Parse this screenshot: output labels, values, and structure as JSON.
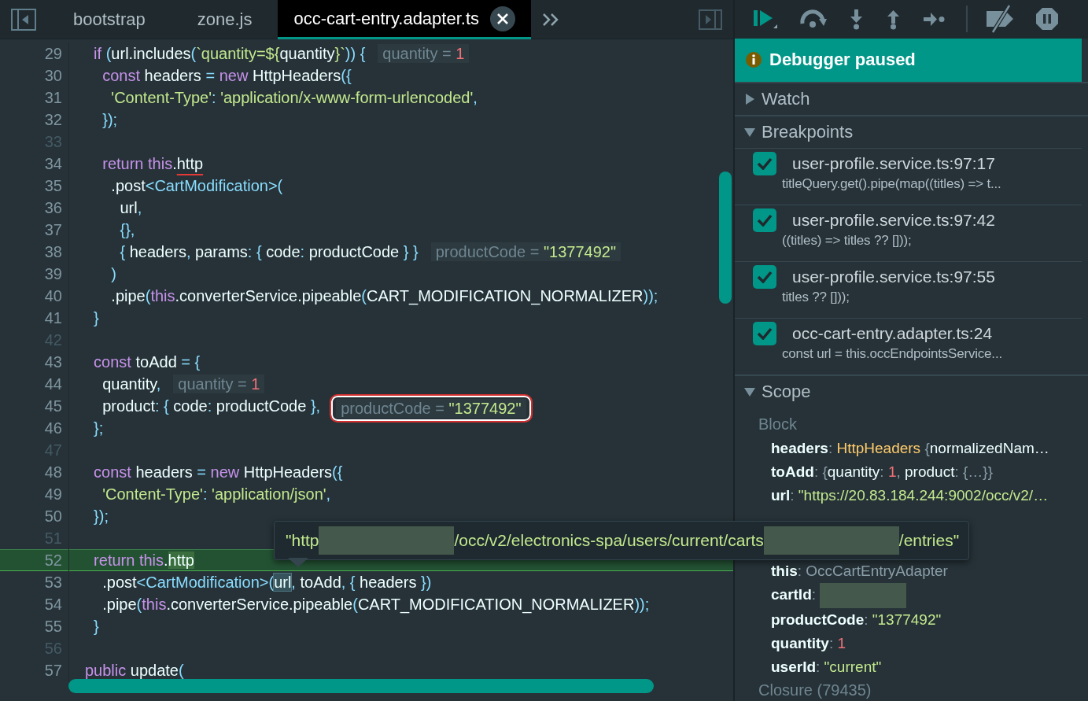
{
  "tabs": [
    {
      "label": "bootstrap",
      "selected": false
    },
    {
      "label": "zone.js",
      "selected": false
    },
    {
      "label": "occ-cart-entry.adapter.ts",
      "selected": true
    }
  ],
  "editor": {
    "lines": [
      {
        "number": "29",
        "paused": false,
        "tokens": [
          {
            "text": "  if ",
            "kind": "kw"
          },
          {
            "text": "(",
            "kind": "p"
          },
          {
            "text": "url.includes",
            "kind": "w"
          },
          {
            "text": "(",
            "kind": "p"
          },
          {
            "text": "`quantity=${",
            "kind": "s"
          },
          {
            "text": "quantity",
            "kind": "w"
          },
          {
            "text": "}`",
            "kind": "s"
          },
          {
            "text": ")) {",
            "kind": "p"
          }
        ],
        "hint": {
          "label": "quantity = ",
          "value": "1",
          "kind": "number",
          "highlighted": false
        }
      },
      {
        "number": "30",
        "paused": false,
        "tokens": [
          {
            "text": "    const ",
            "kind": "kw"
          },
          {
            "text": "headers ",
            "kind": "w"
          },
          {
            "text": "= ",
            "kind": "p"
          },
          {
            "text": "new ",
            "kind": "kw"
          },
          {
            "text": "HttpHeaders",
            "kind": "w"
          },
          {
            "text": "({",
            "kind": "p"
          }
        ]
      },
      {
        "number": "31",
        "paused": false,
        "tokens": [
          {
            "text": "      'Content-Type'",
            "kind": "s"
          },
          {
            "text": ": ",
            "kind": "p"
          },
          {
            "text": "'application/x-www-form-urlencoded'",
            "kind": "s"
          },
          {
            "text": ",",
            "kind": "p"
          }
        ]
      },
      {
        "number": "32",
        "paused": false,
        "tokens": [
          {
            "text": "    });",
            "kind": "p"
          }
        ]
      },
      {
        "number": "33",
        "paused": false
      },
      {
        "number": "34",
        "paused": false,
        "tokens": [
          {
            "text": "    return this",
            "kind": "kw"
          },
          {
            "text": ".",
            "kind": "w"
          },
          {
            "text": "http",
            "kind": "underlined"
          }
        ]
      },
      {
        "number": "35",
        "paused": false,
        "tokens": [
          {
            "text": "      .post",
            "kind": "w"
          },
          {
            "text": "<CartModification>(",
            "kind": "p"
          }
        ]
      },
      {
        "number": "36",
        "paused": false,
        "tokens": [
          {
            "text": "        url",
            "kind": "w"
          },
          {
            "text": ",",
            "kind": "p"
          }
        ]
      },
      {
        "number": "37",
        "paused": false,
        "tokens": [
          {
            "text": "        {},",
            "kind": "p"
          }
        ]
      },
      {
        "number": "38",
        "paused": false,
        "tokens": [
          {
            "text": "        { ",
            "kind": "p"
          },
          {
            "text": "headers",
            "kind": "w"
          },
          {
            "text": ", ",
            "kind": "p"
          },
          {
            "text": "params",
            "kind": "w"
          },
          {
            "text": ": { ",
            "kind": "p"
          },
          {
            "text": "code",
            "kind": "w"
          },
          {
            "text": ": ",
            "kind": "p"
          },
          {
            "text": "productCode",
            "kind": "w"
          },
          {
            "text": " } }",
            "kind": "p"
          }
        ],
        "hint": {
          "label": "productCode = ",
          "value": "\"1377492\"",
          "kind": "string",
          "highlighted": false
        }
      },
      {
        "number": "39",
        "paused": false,
        "tokens": [
          {
            "text": "      )",
            "kind": "p"
          }
        ]
      },
      {
        "number": "40",
        "paused": false,
        "tokens": [
          {
            "text": "      .pipe",
            "kind": "w"
          },
          {
            "text": "(",
            "kind": "p"
          },
          {
            "text": "this",
            "kind": "kw"
          },
          {
            "text": ".converterService.pipeable",
            "kind": "w"
          },
          {
            "text": "(",
            "kind": "p"
          },
          {
            "text": "CART_MODIFICATION_NORMALIZER",
            "kind": "w"
          },
          {
            "text": "));",
            "kind": "p"
          }
        ]
      },
      {
        "number": "41",
        "paused": false,
        "tokens": [
          {
            "text": "  }",
            "kind": "p"
          }
        ]
      },
      {
        "number": "42",
        "paused": false
      },
      {
        "number": "43",
        "paused": false,
        "tokens": [
          {
            "text": "  const ",
            "kind": "kw"
          },
          {
            "text": "toAdd ",
            "kind": "w"
          },
          {
            "text": "= {",
            "kind": "p"
          }
        ]
      },
      {
        "number": "44",
        "paused": false,
        "tokens": [
          {
            "text": "    quantity",
            "kind": "w"
          },
          {
            "text": ",",
            "kind": "p"
          }
        ],
        "hint": {
          "label": "quantity = ",
          "value": "1",
          "kind": "number",
          "highlighted": false
        }
      },
      {
        "number": "45",
        "paused": false,
        "tokens": [
          {
            "text": "    product",
            "kind": "w"
          },
          {
            "text": ": { ",
            "kind": "p"
          },
          {
            "text": "code",
            "kind": "w"
          },
          {
            "text": ": ",
            "kind": "p"
          },
          {
            "text": "productCode",
            "kind": "w"
          },
          {
            "text": " },",
            "kind": "p"
          }
        ],
        "hint": {
          "label": "productCode = ",
          "value": "\"1377492\"",
          "kind": "string",
          "highlighted": true
        }
      },
      {
        "number": "46",
        "paused": false,
        "tokens": [
          {
            "text": "  };",
            "kind": "p"
          }
        ]
      },
      {
        "number": "47",
        "paused": false
      },
      {
        "number": "48",
        "paused": false,
        "tokens": [
          {
            "text": "  const ",
            "kind": "kw"
          },
          {
            "text": "headers ",
            "kind": "w"
          },
          {
            "text": "= ",
            "kind": "p"
          },
          {
            "text": "new ",
            "kind": "kw"
          },
          {
            "text": "HttpHeaders",
            "kind": "w"
          },
          {
            "text": "({",
            "kind": "p"
          }
        ]
      },
      {
        "number": "49",
        "paused": false,
        "tokens": [
          {
            "text": "    'Content-Type'",
            "kind": "s"
          },
          {
            "text": ": ",
            "kind": "p"
          },
          {
            "text": "'application/json'",
            "kind": "s"
          },
          {
            "text": ",",
            "kind": "p"
          }
        ]
      },
      {
        "number": "50",
        "paused": false,
        "tokens": [
          {
            "text": "  });",
            "kind": "p"
          }
        ]
      },
      {
        "number": "51",
        "paused": false
      },
      {
        "number": "52",
        "paused": true,
        "tokens": [
          {
            "text": "  return this",
            "kind": "kw"
          },
          {
            "text": ".",
            "kind": "w"
          },
          {
            "text": "http",
            "kind": "current"
          }
        ]
      },
      {
        "number": "53",
        "paused": false,
        "tokens": [
          {
            "text": "    .post",
            "kind": "w"
          },
          {
            "text": "<CartModification>(",
            "kind": "p"
          },
          {
            "text": "url",
            "kind": "hovered"
          },
          {
            "text": ", ",
            "kind": "p"
          },
          {
            "text": "toAdd",
            "kind": "w"
          },
          {
            "text": ", { ",
            "kind": "p"
          },
          {
            "text": "headers",
            "kind": "w"
          },
          {
            "text": " })",
            "kind": "p"
          }
        ]
      },
      {
        "number": "54",
        "paused": false,
        "tokens": [
          {
            "text": "    .pipe",
            "kind": "w"
          },
          {
            "text": "(",
            "kind": "p"
          },
          {
            "text": "this",
            "kind": "kw"
          },
          {
            "text": ".converterService.pipeable",
            "kind": "w"
          },
          {
            "text": "(",
            "kind": "p"
          },
          {
            "text": "CART_MODIFICATION_NORMALIZER",
            "kind": "w"
          },
          {
            "text": "));",
            "kind": "p"
          }
        ]
      },
      {
        "number": "55",
        "paused": false,
        "tokens": [
          {
            "text": "  }",
            "kind": "p"
          }
        ]
      },
      {
        "number": "56",
        "paused": false
      },
      {
        "number": "57",
        "paused": false,
        "tokens": [
          {
            "text": "public ",
            "kind": "kw"
          },
          {
            "text": "update",
            "kind": "w"
          },
          {
            "text": "(",
            "kind": "p"
          }
        ]
      }
    ]
  },
  "tooltip": {
    "parts": [
      {
        "kind": "text",
        "text": "\"http"
      },
      {
        "kind": "redacted"
      },
      {
        "kind": "text",
        "text": "/occ/v2/electronics-spa/users/current/carts"
      },
      {
        "kind": "redacted"
      },
      {
        "kind": "text",
        "text": "/entries\""
      }
    ]
  },
  "debugger": {
    "status": "Debugger paused",
    "sections": [
      {
        "kind": "watch",
        "title": "Watch",
        "expanded": false
      },
      {
        "kind": "breakpoints",
        "title": "Breakpoints",
        "expanded": true,
        "items": [
          {
            "location": "user-profile.service.ts:97:17",
            "snippet": "titleQuery.get().pipe(map((titles) => t...",
            "checked": true
          },
          {
            "location": "user-profile.service.ts:97:42",
            "snippet": "((titles) => titles ?? []));",
            "checked": true
          },
          {
            "location": "user-profile.service.ts:97:55",
            "snippet": "titles ?? []));",
            "checked": true
          },
          {
            "location": "occ-cart-entry.adapter.ts:24",
            "snippet": "const url = this.occEndpointsService...",
            "checked": true
          }
        ]
      },
      {
        "kind": "scope",
        "title": "Scope",
        "expanded": true,
        "block": "Block",
        "closure": "Closure (79435)",
        "entries": [
          {
            "key": "headers",
            "value": [
              {
                "text": ": ",
                "kind": "dim"
              },
              {
                "text": "HttpHeaders ",
                "kind": "cls"
              },
              {
                "text": "{",
                "kind": "dim"
              },
              {
                "text": "normalizedNam…",
                "kind": "w"
              }
            ]
          },
          {
            "key": "toAdd",
            "value": [
              {
                "text": ": {",
                "kind": "dim"
              },
              {
                "text": "quantity",
                "kind": "w"
              },
              {
                "text": ": ",
                "kind": "dim"
              },
              {
                "text": "1",
                "kind": "num"
              },
              {
                "text": ", ",
                "kind": "dim"
              },
              {
                "text": "product",
                "kind": "w"
              },
              {
                "text": ": {…}}",
                "kind": "dim"
              }
            ]
          },
          {
            "key": "url",
            "value": [
              {
                "text": ": ",
                "kind": "dim"
              },
              {
                "text": "\"https://20.83.184.244:9002/occ/v2/…",
                "kind": "str"
              }
            ]
          },
          {
            "key": "this",
            "value": [
              {
                "text": ": ",
                "kind": "dim"
              },
              {
                "text": "OccCartEntryAdapter",
                "kind": "dim"
              }
            ]
          },
          {
            "key": "cartId",
            "value": [
              {
                "text": ": ",
                "kind": "dim"
              },
              {
                "kind": "redacted"
              }
            ]
          },
          {
            "key": "productCode",
            "value": [
              {
                "text": ": ",
                "kind": "dim"
              },
              {
                "text": "\"1377492\"",
                "kind": "str"
              }
            ]
          },
          {
            "key": "quantity",
            "value": [
              {
                "text": ": ",
                "kind": "dim"
              },
              {
                "text": "1",
                "kind": "num"
              }
            ]
          },
          {
            "key": "userId",
            "value": [
              {
                "text": ": ",
                "kind": "dim"
              },
              {
                "text": "\"current\"",
                "kind": "str"
              }
            ]
          }
        ]
      }
    ]
  }
}
